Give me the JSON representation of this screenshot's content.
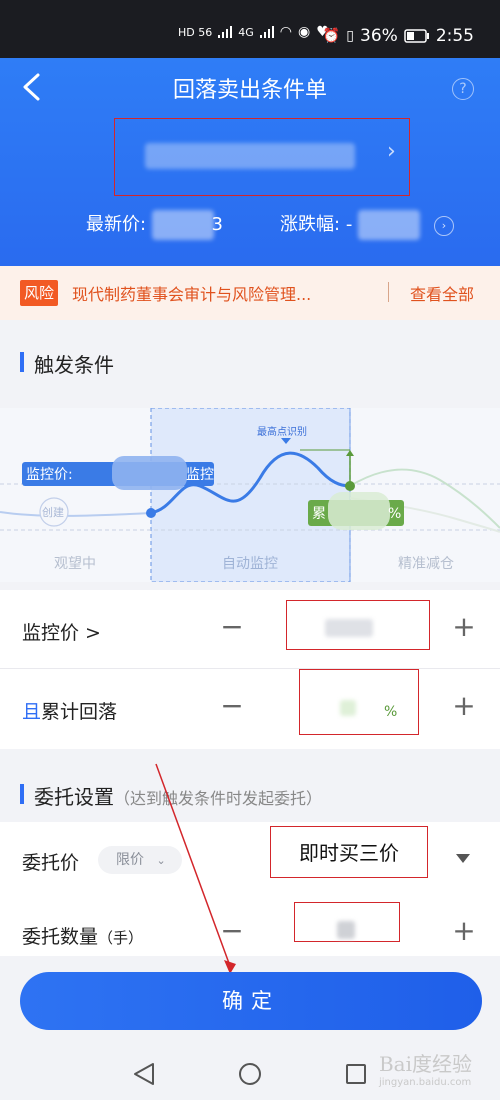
{
  "status_bar": {
    "net_left": "HD 56",
    "net_mid": "4G",
    "battery": "36%",
    "time": "2:55"
  },
  "header": {
    "title": "回落卖出条件单",
    "help": "?",
    "latest_price_label": "最新价:",
    "latest_price_suffix": "3",
    "change_label": "涨跌幅:",
    "change_prefix": "-"
  },
  "risk": {
    "badge": "风险",
    "text": "现代制药董事会审计与风险管理...",
    "view_all": "查看全部"
  },
  "trigger_section": {
    "title": "触发条件"
  },
  "chart": {
    "peak_label": "最高点识别",
    "monitor_price_tag": "监控价:",
    "monitor_tag_end": "监控",
    "create_label": "创建",
    "drop_tag_start": "累",
    "drop_tag_end": "%",
    "stages": [
      "观望中",
      "自动监控",
      "精准减仓"
    ]
  },
  "monitor_price": {
    "label": "监控价 >"
  },
  "cumulative_drop": {
    "label_prefix": "且",
    "label": "累计回落",
    "unit": "%"
  },
  "order_section": {
    "title": "委托设置",
    "subtitle": "（达到触发条件时发起委托）"
  },
  "order_price": {
    "label": "委托价",
    "type_select": "限价",
    "value": "即时买三价"
  },
  "order_quantity": {
    "label": "委托数量",
    "unit": "（手）"
  },
  "confirm": {
    "label": "确定"
  },
  "watermark": {
    "brand": "Bai度经验",
    "url": "jingyan.baidu.com"
  },
  "colors": {
    "primary": "#2f6ef5",
    "risk": "#f25a24",
    "annotation": "#d3262b",
    "green": "#5a9a3a"
  }
}
